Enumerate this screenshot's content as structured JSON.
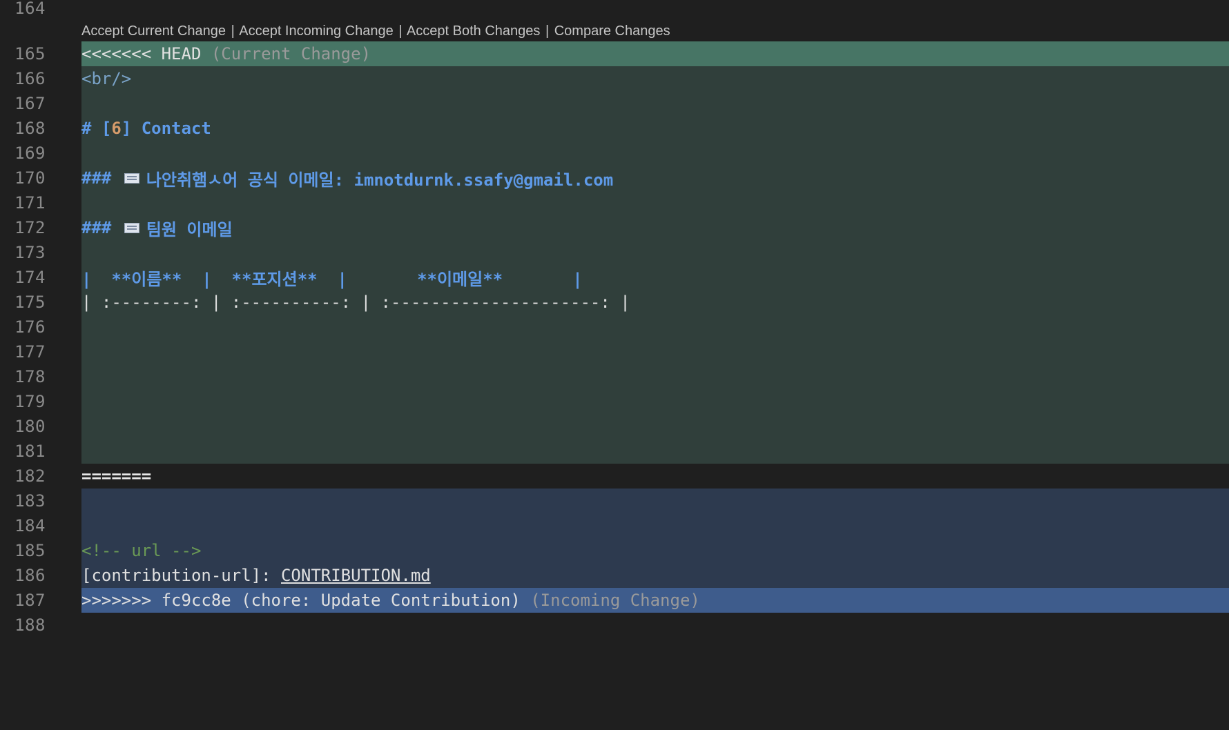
{
  "codelens": {
    "accept_current": "Accept Current Change",
    "accept_incoming": "Accept Incoming Change",
    "accept_both": "Accept Both Changes",
    "compare": "Compare Changes",
    "separator": "|"
  },
  "lines": {
    "n164": "164",
    "n165": "165",
    "n166": "166",
    "n167": "167",
    "n168": "168",
    "n169": "169",
    "n170": "170",
    "n171": "171",
    "n172": "172",
    "n173": "173",
    "n174": "174",
    "n175": "175",
    "n176": "176",
    "n177": "177",
    "n178": "178",
    "n179": "179",
    "n180": "180",
    "n181": "181",
    "n182": "182",
    "n183": "183",
    "n184": "184",
    "n185": "185",
    "n186": "186",
    "n187": "187",
    "n188": "188"
  },
  "code": {
    "head_marker": "<<<<<<< HEAD",
    "head_label": "(Current Change)",
    "br": "<br/>",
    "contact_hash": "# [",
    "contact_num": "6",
    "contact_rest": "] Contact",
    "email_hash": "###",
    "email_label": "나안취햄ㅅ어 공식 이메일: imnotdurnk.ssafy@gmail.com",
    "team_hash": "###",
    "team_label": "팀원 이메일",
    "table_header": "|  **이름**  |  **포지션**  |       **이메일**       |",
    "table_align": "| :--------: | :----------: | :---------------------: |",
    "separator_marker": "=======",
    "comment": "<!-- url -->",
    "contribution_prefix": "[contribution-url]: ",
    "contribution_link": "CONTRIBUTION.md",
    "incoming_marker": ">>>>>>> fc9cc8e (chore: Update Contribution)",
    "incoming_label": "(Incoming Change)"
  },
  "icons": {
    "mail": "envelope-icon"
  }
}
